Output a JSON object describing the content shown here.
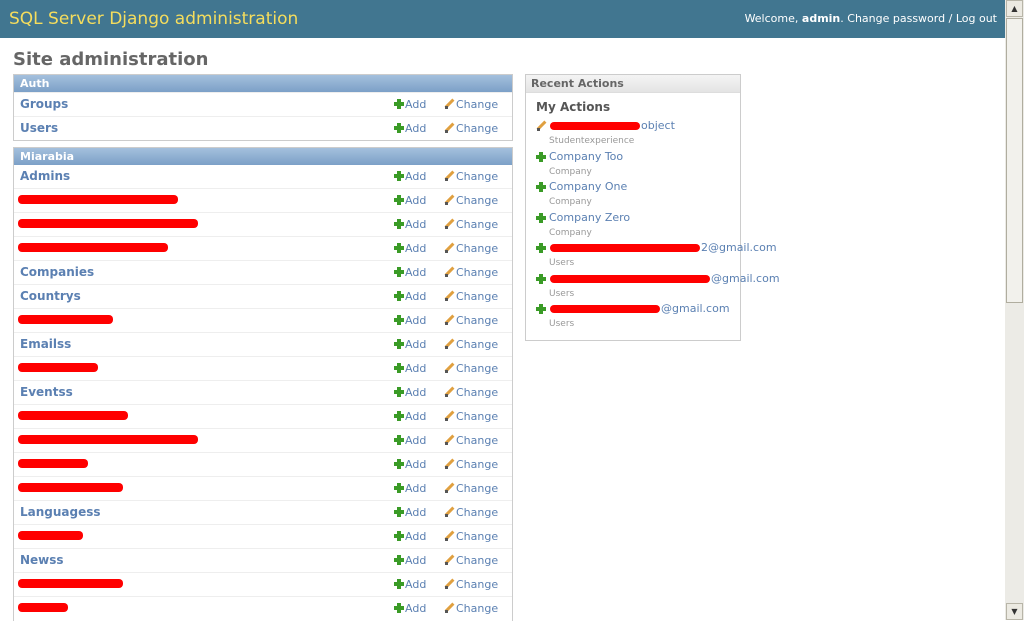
{
  "header": {
    "branding": "SQL Server Django administration",
    "welcome": "Welcome,",
    "username": "admin",
    "change_password": "Change password",
    "separator": "/",
    "logout": "Log out"
  },
  "page_title": "Site administration",
  "modules": [
    {
      "caption": "Auth",
      "rows": [
        {
          "name": "Groups",
          "add": "Add",
          "change": "Change"
        },
        {
          "name": "Users",
          "add": "Add",
          "change": "Change"
        }
      ]
    },
    {
      "caption": "Miarabia",
      "rows": [
        {
          "name": "Admins",
          "add": "Add",
          "change": "Change"
        },
        {
          "name": "",
          "add": "Add",
          "change": "Change"
        },
        {
          "name": "",
          "add": "Add",
          "change": "Change"
        },
        {
          "name": "",
          "add": "Add",
          "change": "Change"
        },
        {
          "name": "Companies",
          "add": "Add",
          "change": "Change"
        },
        {
          "name": "Countrys",
          "add": "Add",
          "change": "Change"
        },
        {
          "name": "",
          "add": "Add",
          "change": "Change"
        },
        {
          "name": "Emailss",
          "add": "Add",
          "change": "Change"
        },
        {
          "name": "",
          "add": "Add",
          "change": "Change"
        },
        {
          "name": "Eventss",
          "add": "Add",
          "change": "Change"
        },
        {
          "name": "",
          "add": "Add",
          "change": "Change"
        },
        {
          "name": "",
          "add": "Add",
          "change": "Change"
        },
        {
          "name": "",
          "add": "Add",
          "change": "Change"
        },
        {
          "name": "",
          "add": "Add",
          "change": "Change"
        },
        {
          "name": "Languagess",
          "add": "Add",
          "change": "Change"
        },
        {
          "name": "",
          "add": "Add",
          "change": "Change"
        },
        {
          "name": "Newss",
          "add": "Add",
          "change": "Change"
        },
        {
          "name": "",
          "add": "Add",
          "change": "Change"
        },
        {
          "name": "",
          "add": "Add",
          "change": "Change"
        }
      ]
    }
  ],
  "recent_actions": {
    "caption": "Recent Actions",
    "heading": "My Actions",
    "items": [
      {
        "title": "object",
        "type": "Studentexperience",
        "icon": "pencil-icon"
      },
      {
        "title": "Company Too",
        "type": "Company",
        "icon": "plus-icon"
      },
      {
        "title": "Company One",
        "type": "Company",
        "icon": "plus-icon"
      },
      {
        "title": "Company Zero",
        "type": "Company",
        "icon": "plus-icon"
      },
      {
        "title": "2@gmail.com",
        "type": "Users",
        "icon": "plus-icon"
      },
      {
        "title": "@gmail.com",
        "type": "Users",
        "icon": "plus-icon"
      },
      {
        "title": "@gmail.com",
        "type": "Users",
        "icon": "plus-icon"
      }
    ]
  },
  "colors": {
    "header_bg": "#417690",
    "branding": "#f5dd5d",
    "link": "#5b80b2",
    "module_caption": "#7ca0c7",
    "redaction": "#ff0000"
  }
}
